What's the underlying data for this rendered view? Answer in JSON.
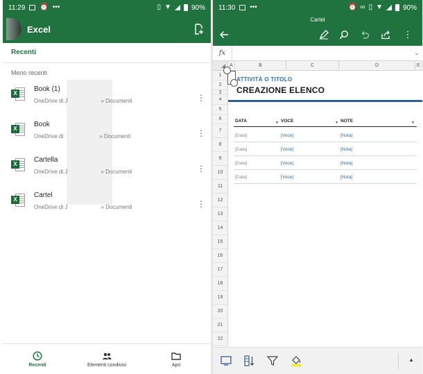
{
  "left": {
    "status": {
      "time": "11:29",
      "dots": "•••",
      "battery": "90%"
    },
    "app_title": "Excel",
    "section_recent": "Recenti",
    "section_older": "Meno recenti",
    "files": [
      {
        "name": "Book (1)",
        "path_prefix": "OneDrive di J",
        "path_suffix": "» Documenti"
      },
      {
        "name": "Book",
        "path_prefix": "OneDrive di",
        "path_suffix": "» Documenti"
      },
      {
        "name": "Cartella",
        "path_prefix": "OneDrive di J",
        "path_suffix": "» Documenti"
      },
      {
        "name": "Cartel",
        "path_prefix": "OneDrive di J",
        "path_suffix": "» Documenti"
      }
    ],
    "nav": [
      {
        "label": "Recenti",
        "icon": "clock-icon",
        "active": true
      },
      {
        "label": "Elementi condivisi",
        "icon": "people-icon",
        "active": false
      },
      {
        "label": "Apri",
        "icon": "folder-icon",
        "active": false
      }
    ]
  },
  "right": {
    "status": {
      "time": "11:30",
      "dots": "•••",
      "battery": "90%"
    },
    "doc_title": "Cartel",
    "formula_label": "fx",
    "columns": [
      "A",
      "B",
      "C",
      "D",
      "E"
    ],
    "rows": [
      "1",
      "2",
      "3",
      "4",
      "5",
      "6",
      "7",
      "8",
      "9",
      "10",
      "11",
      "12",
      "13",
      "14",
      "15",
      "16",
      "17",
      "18",
      "19",
      "20",
      "21",
      "22"
    ],
    "subtitle": "ATTIVITÀ O TITOLO",
    "title": "CREAZIONE ELENCO",
    "table_headers": [
      "DATA",
      "VOCE",
      "NOTE"
    ],
    "table_rows": [
      [
        "[Data]",
        "[Voce]",
        "[Nota]"
      ],
      [
        "[Data]",
        "[Voce]",
        "[Nota]"
      ],
      [
        "[Data]",
        "[Voce]",
        "[Nota]"
      ],
      [
        "[Data]",
        "[Voce]",
        "[Nota]"
      ]
    ],
    "colors": {
      "accent": "#20733f",
      "title_blue": "#2f6da3",
      "rule_blue": "#2e5f8e"
    }
  }
}
